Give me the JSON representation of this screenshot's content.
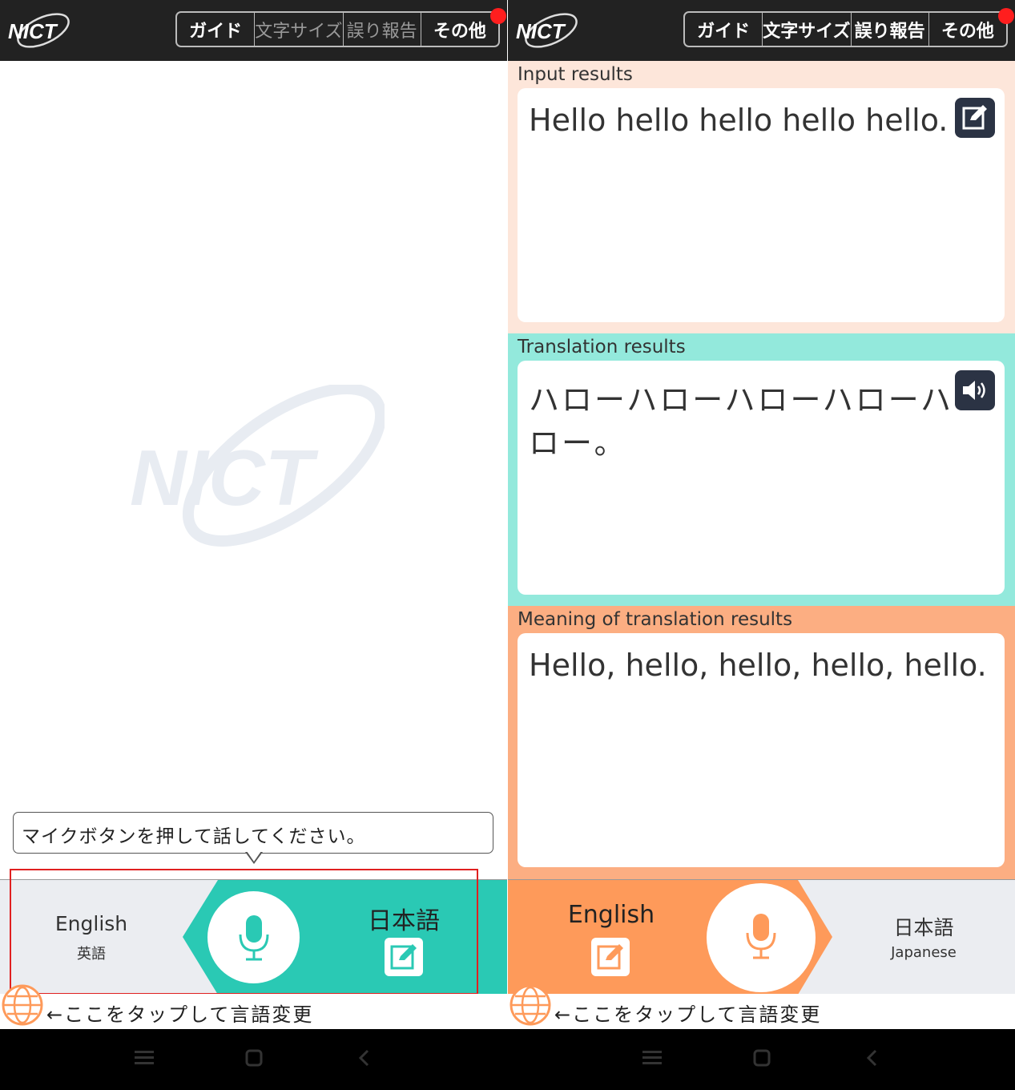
{
  "menu": {
    "guide": "ガイド",
    "font_size": "文字サイズ",
    "report": "誤り報告",
    "other": "その他"
  },
  "left": {
    "prompt": "マイクボタンを押して話してください。",
    "source_lang": "English",
    "source_lang_sub": "英語",
    "target_lang": "日本語",
    "change_hint": "←ここをタップして言語変更"
  },
  "right": {
    "input_label": "Input results",
    "input_text": "Hello hello hello hello hello.",
    "translation_label": "Translation results",
    "translation_line1": "ハローハローハローハローハ",
    "translation_line2": "ロー。",
    "meaning_label": "Meaning of translation results",
    "meaning_text": "Hello, hello, hello, hello, hello.",
    "source_lang": "English",
    "target_lang": "日本語",
    "target_lang_sub": "Japanese",
    "change_hint": "←ここをタップして言語変更"
  },
  "colors": {
    "teal": "#2ac9b4",
    "orange": "#fe9a5a",
    "input_bg": "#fde6da",
    "translation_bg": "#93e9dc",
    "meaning_bg": "#fcae82",
    "topbar": "#222222"
  },
  "icons": [
    "nict-logo",
    "edit-icon",
    "speaker-icon",
    "mic-icon",
    "globe-icon",
    "menu-icon",
    "home-icon",
    "back-icon"
  ]
}
